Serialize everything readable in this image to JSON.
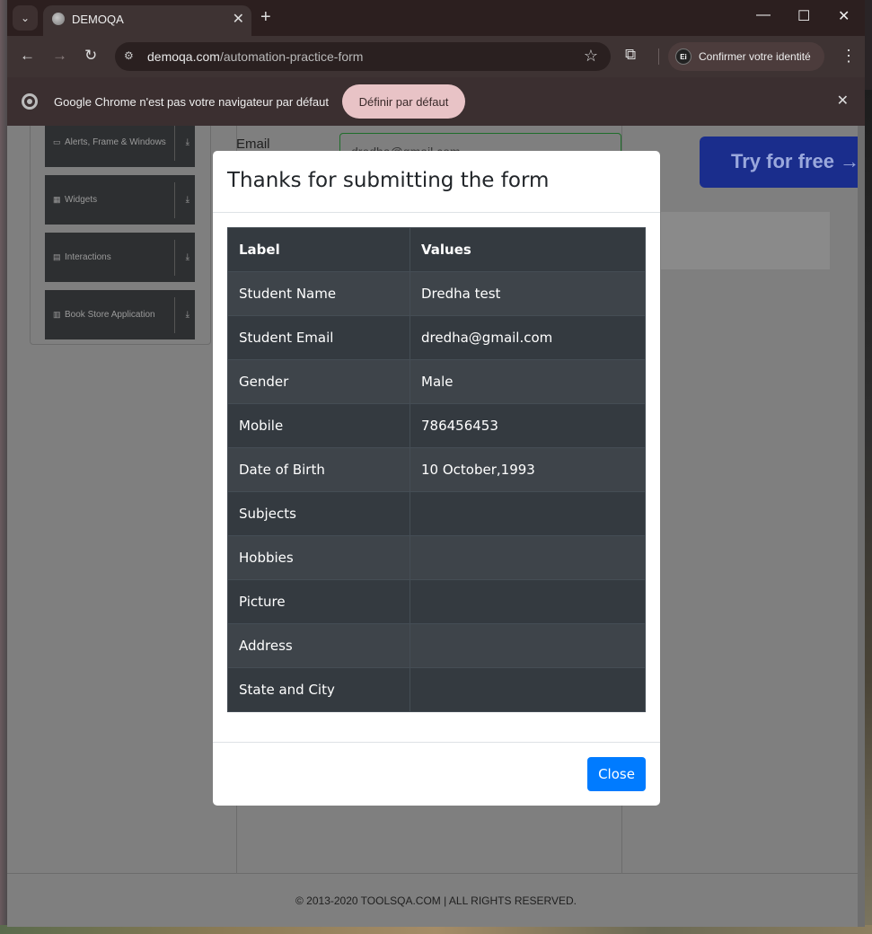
{
  "browser": {
    "tab_title": "DEMOQA",
    "url_host": "demoqa.com",
    "url_path": "/automation-practice-form",
    "profile_label": "Confirmer votre identité",
    "profile_initials": "Ei"
  },
  "infobar": {
    "message": "Google Chrome n'est pas votre navigateur par défaut",
    "button": "Définir par défaut"
  },
  "sidebar": {
    "items": [
      {
        "label": "Alerts, Frame & Windows"
      },
      {
        "label": "Widgets"
      },
      {
        "label": "Interactions"
      },
      {
        "label": "Book Store Application"
      }
    ]
  },
  "form": {
    "email_label": "Email",
    "email_value": "dredha@gmail.com"
  },
  "ad": {
    "try_label": "Try for free →"
  },
  "modal": {
    "title": "Thanks for submitting the form",
    "header_label": "Label",
    "header_values": "Values",
    "rows": [
      {
        "label": "Student Name",
        "value": "Dredha test"
      },
      {
        "label": "Student Email",
        "value": "dredha@gmail.com"
      },
      {
        "label": "Gender",
        "value": "Male"
      },
      {
        "label": "Mobile",
        "value": "786456453"
      },
      {
        "label": "Date of Birth",
        "value": "10 October,1993"
      },
      {
        "label": "Subjects",
        "value": ""
      },
      {
        "label": "Hobbies",
        "value": ""
      },
      {
        "label": "Picture",
        "value": ""
      },
      {
        "label": "Address",
        "value": ""
      },
      {
        "label": "State and City",
        "value": ""
      }
    ],
    "close_label": "Close"
  },
  "footer": {
    "text": "© 2013-2020 TOOLSQA.COM | ALL RIGHTS RESERVED."
  },
  "colors": {
    "primary": "#007bff",
    "table_dark": "#343a40",
    "valid": "#28a745"
  }
}
